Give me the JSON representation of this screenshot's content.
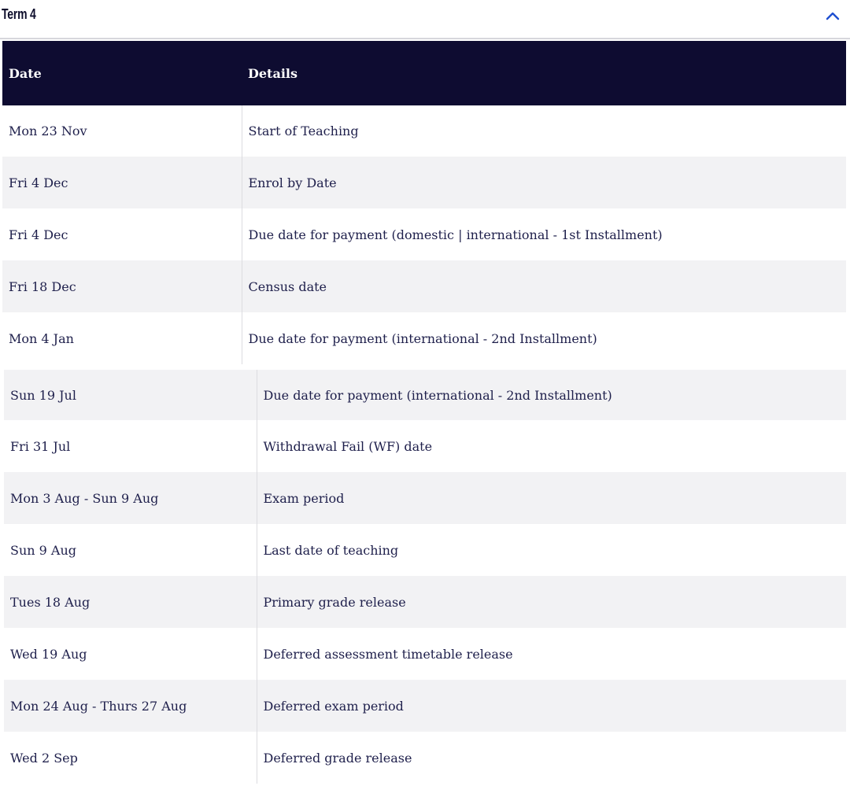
{
  "accordion": {
    "title": "Term 4",
    "toggle_icon": "chevron-up-icon",
    "accent": "#1f4fd1"
  },
  "table": {
    "header_bg": "#0e0c31",
    "headers": {
      "date": "Date",
      "details": "Details"
    },
    "rows_top": [
      {
        "date": "Mon 23 Nov",
        "details": "Start of Teaching"
      },
      {
        "date": "Fri 4 Dec",
        "details": "Enrol by Date"
      },
      {
        "date": "Fri 4 Dec",
        "details": "Due date for payment (domestic | international - 1st Installment)"
      },
      {
        "date": "Fri 18 Dec",
        "details": "Census date"
      },
      {
        "date": "Mon 4 Jan",
        "details": "Due date for payment (international - 2nd Installment)"
      }
    ],
    "rows_bottom": [
      {
        "date": "Sun 19 Jul",
        "details": "Due date for payment (international - 2nd Installment)"
      },
      {
        "date": "Fri 31 Jul",
        "details": "Withdrawal Fail (WF) date"
      },
      {
        "date": "Mon 3 Aug - Sun 9 Aug",
        "details": "Exam period"
      },
      {
        "date": "Sun 9 Aug",
        "details": "Last date of teaching"
      },
      {
        "date": "Tues 18 Aug",
        "details": "Primary grade release"
      },
      {
        "date": "Wed 19 Aug",
        "details": "Deferred assessment timetable release"
      },
      {
        "date": "Mon 24 Aug - Thurs 27 Aug",
        "details": "Deferred exam period"
      },
      {
        "date": "Wed 2 Sep",
        "details": "Deferred grade release"
      }
    ]
  }
}
